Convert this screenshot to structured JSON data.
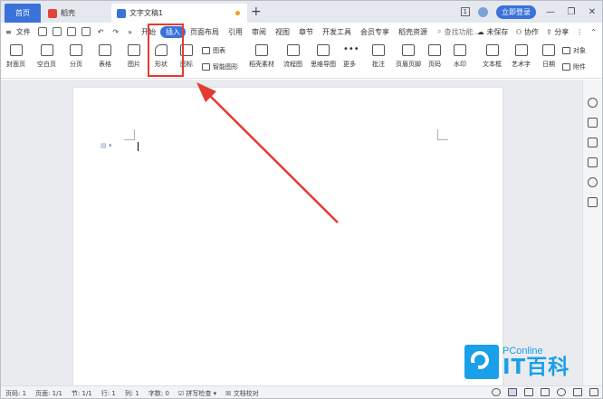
{
  "tabs": {
    "home": "首页",
    "daoke": "稻壳",
    "doc": "文字文稿1",
    "add": "+"
  },
  "titlebar_right": {
    "badge": "1",
    "login": "立即登录",
    "minimize": "—",
    "restore": "❐",
    "close": "✕"
  },
  "menu": {
    "file": "文件",
    "more": "»",
    "items": [
      "开始",
      "插入",
      "页面布局",
      "引用",
      "审阅",
      "视图",
      "章节",
      "开发工具",
      "会员专享",
      "稻壳资源"
    ],
    "active_index": 1,
    "search": "查找功能...",
    "unsaved": "未保存",
    "collab": "协作",
    "share": "分享"
  },
  "ribbon": {
    "cover": "封面页",
    "blank": "空白页",
    "break": "分页",
    "table": "表格",
    "picture": "图片",
    "shape": "形状",
    "icon": "图标",
    "chart": "图表",
    "smartart": "智能图形",
    "daoke_material": "稻壳素材",
    "flowchart": "流程图",
    "mindmap": "思维导图",
    "more": "更多",
    "comment": "批注",
    "header_footer": "页眉页脚",
    "page_num": "页码",
    "watermark": "水印",
    "textbox": "文本框",
    "wordart": "艺术字",
    "date": "日期",
    "object": "对象",
    "attachment": "附件"
  },
  "status": {
    "row": "页码: 1",
    "pages": "页面: 1/1",
    "section": "节: 1/1",
    "line": "行: 1",
    "col": "列: 1",
    "words": "字数: 0",
    "spell": "拼写检查",
    "proof": "文档校对"
  },
  "watermark": {
    "brand": "PConline",
    "title": "IT百科"
  },
  "colors": {
    "accent": "#3a72d9",
    "highlight": "#e23b32",
    "watermark": "#1aa0e8"
  }
}
